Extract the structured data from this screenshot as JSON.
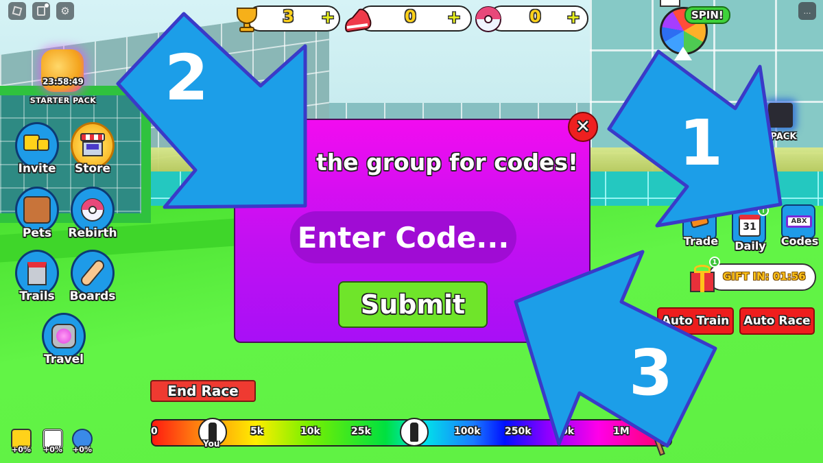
{
  "hud": {
    "top_left_buttons": [
      {
        "icon": "roblox-logo-icon"
      },
      {
        "icon": "chat-notes-icon"
      },
      {
        "icon": "gear-icon"
      }
    ],
    "starter_pack": {
      "timer": "23:58:49",
      "label": "STARTER PACK"
    },
    "currencies": [
      {
        "icon": "trophy-icon",
        "value": "3",
        "plus": "+"
      },
      {
        "icon": "shoe-icon",
        "value": "0",
        "plus": "+"
      },
      {
        "icon": "rebirth-orb-icon",
        "value": "0",
        "plus": "+"
      }
    ],
    "spin": {
      "label": "SPIN!"
    },
    "chat_icon": "…"
  },
  "left_menu": [
    {
      "label": "Invite",
      "icon": "friends-icon"
    },
    {
      "label": "Store",
      "icon": "store-icon"
    },
    {
      "label": "Pets",
      "icon": "dog-icon"
    },
    {
      "label": "Rebirth",
      "icon": "rebirth-icon"
    },
    {
      "label": "Trails",
      "icon": "paint-bucket-icon"
    },
    {
      "label": "Boards",
      "icon": "skateboard-icon"
    },
    {
      "label": "Travel",
      "icon": "portal-icon"
    }
  ],
  "right_menu": {
    "pack_label": "T PACK",
    "buttons": [
      {
        "label": "Trade",
        "icon": "trade-icon"
      },
      {
        "label": "Daily",
        "icon": "calendar-icon",
        "calendar_day": "31",
        "badge": "!"
      },
      {
        "label": "Codes",
        "icon": "code-ticket-icon",
        "ticket_text": "ABX"
      }
    ],
    "gift": {
      "label": "GIFT IN: 01:56",
      "badge": "1"
    },
    "auto_train": "Auto Train",
    "auto_race": "Auto Race"
  },
  "dialog": {
    "title": "the group for codes!",
    "input_placeholder": "Enter Code...",
    "input_value": "",
    "submit_label": "Submit",
    "close_label": "✕"
  },
  "race": {
    "end_race_label": "End Race",
    "progress_ticks": [
      "0",
      "5k",
      "10k",
      "25k",
      "100k",
      "250k",
      "500k",
      "1M"
    ],
    "visible_tick_labels": [
      "0",
      "5k",
      "10k",
      "25k",
      "100k",
      "250k",
      "0k",
      "1M"
    ],
    "player_label": "You"
  },
  "boosts": [
    {
      "icon": "friends-boost-icon",
      "value": "+0%"
    },
    {
      "icon": "maze-boost-icon",
      "value": "+0%"
    },
    {
      "icon": "gear-boost-icon",
      "value": "+0%"
    }
  ],
  "annotations": [
    {
      "number": "1",
      "target": "Codes button"
    },
    {
      "number": "2",
      "target": "Code input field"
    },
    {
      "number": "3",
      "target": "Submit button"
    }
  ]
}
